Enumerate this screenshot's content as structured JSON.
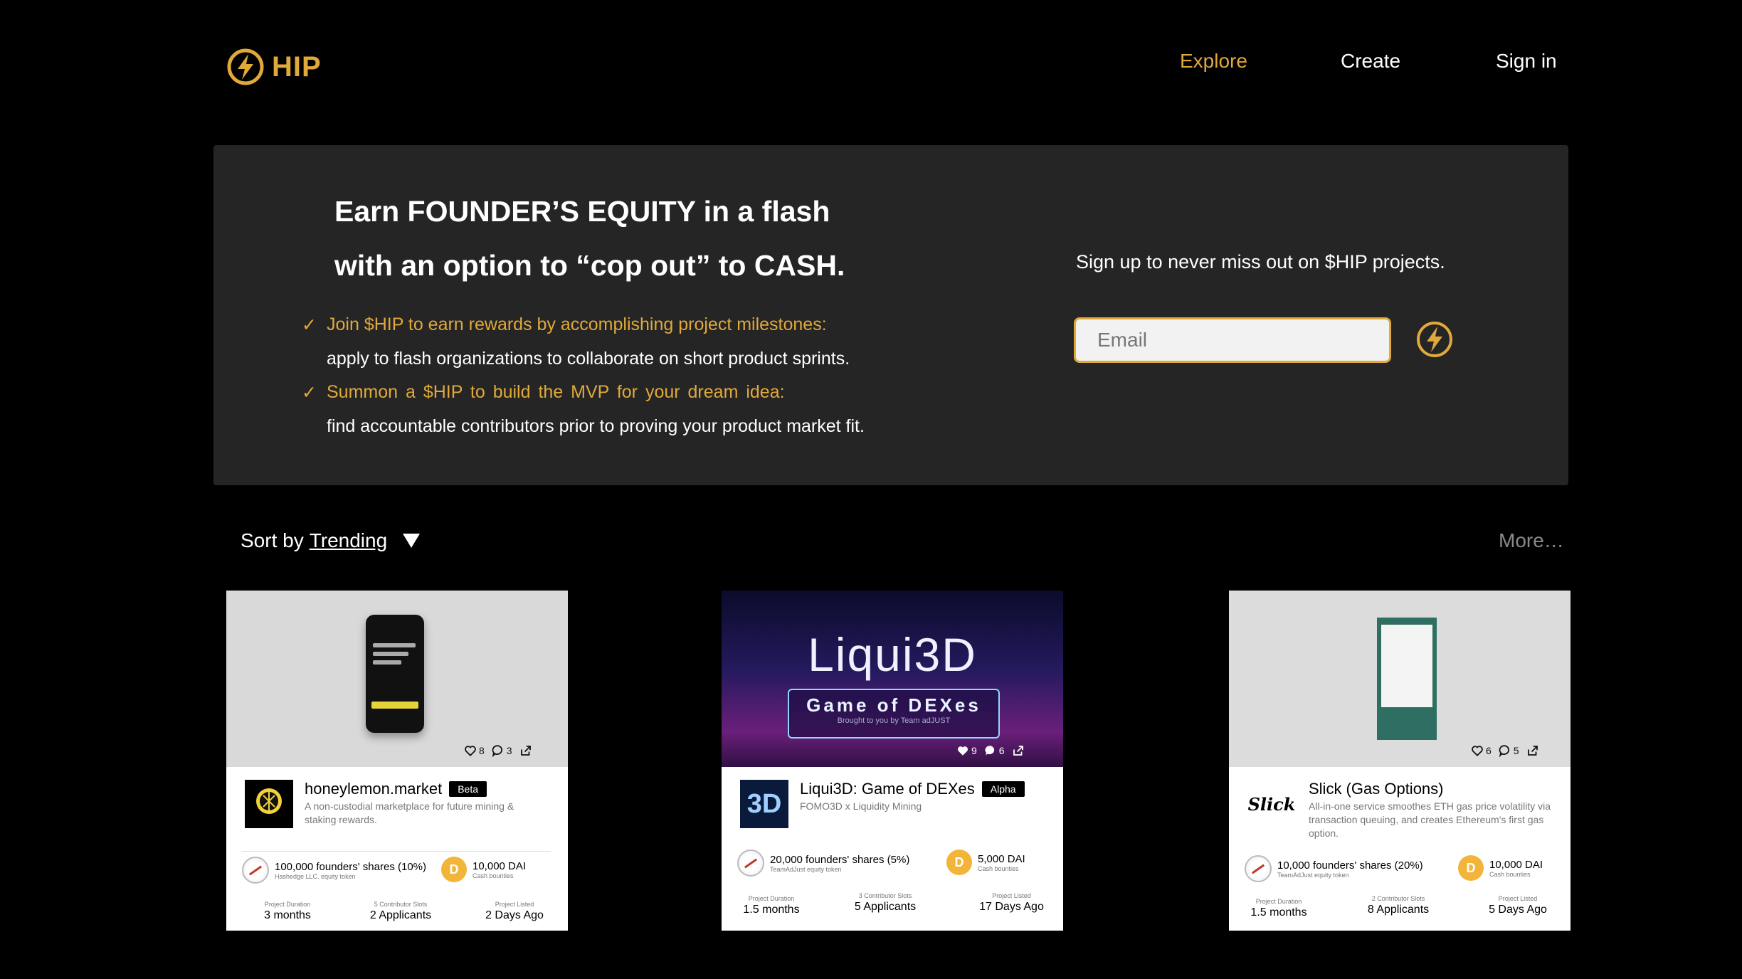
{
  "header": {
    "logo_text": "HIP",
    "nav": {
      "explore": "Explore",
      "create": "Create",
      "signin": "Sign in"
    },
    "accent_color": "#e0a93a"
  },
  "hero": {
    "headline_line1": "Earn FOUNDER’S EQUITY in a flash",
    "headline_line2": "with an option to “cop out” to CASH.",
    "bullets": [
      {
        "check": "✓",
        "title": "Join $HIP to earn rewards by accomplishing project milestones:",
        "desc": "apply to flash organizations to collaborate on short product sprints."
      },
      {
        "check": "✓",
        "title": "Summon a $HIP to build the MVP for your dream idea:",
        "desc": "find accountable contributors prior to proving your product market fit."
      }
    ],
    "signup_text": "Sign up to never miss out on $HIP projects.",
    "email_placeholder": "Email"
  },
  "sort": {
    "prefix": "Sort by",
    "value": "Trending",
    "more": "More…"
  },
  "cards": [
    {
      "likes": "8",
      "comments": "3",
      "title": "honeylemon.market",
      "badge": "Beta",
      "desc": "A non-custodial marketplace for future mining & staking rewards.",
      "shares": "100,000 founders' shares (10%)",
      "shares_sub": "Hashedge LLC. equity token",
      "cash": "10,000 DAI",
      "cash_sub": "Cash bounties",
      "duration_label": "Project Duration",
      "duration": "3 months",
      "slots_label": "5 Contributor Slots",
      "slots": "2 Applicants",
      "listed_label": "Project Listed",
      "listed": "2 Days Ago"
    },
    {
      "likes": "9",
      "comments": "6",
      "thumb_title": "Liqui3D",
      "thumb_sub": "Game of DEXes",
      "thumb_tiny": "Brought to you by Team adJUST",
      "avatar_text": "3D",
      "title": "Liqui3D: Game of DEXes",
      "badge": "Alpha",
      "desc": "FOMO3D x Liquidity Mining",
      "shares": "20,000 founders' shares (5%)",
      "shares_sub": "TeamAdJust equity token",
      "cash": "5,000 DAI",
      "cash_sub": "Cash bounties",
      "duration_label": "Project Duration",
      "duration": "1.5 months",
      "slots_label": "3 Contributor Slots",
      "slots": "5 Applicants",
      "listed_label": "Project Listed",
      "listed": "17 Days Ago"
    },
    {
      "likes": "6",
      "comments": "5",
      "avatar_text": "Slick",
      "title": "Slick (Gas Options)",
      "desc": "All-in-one service smoothes ETH gas price volatility via transaction queuing, and creates Ethereum's first gas option.",
      "shares": "10,000 founders' shares (20%)",
      "shares_sub": "TeamAdJust equity token",
      "cash": "10,000 DAI",
      "cash_sub": "Cash bounties",
      "duration_label": "Project Duration",
      "duration": "1.5 months",
      "slots_label": "2 Contributor Slots",
      "slots": "8 Applicants",
      "listed_label": "Project Listed",
      "listed": "5 Days Ago"
    }
  ]
}
